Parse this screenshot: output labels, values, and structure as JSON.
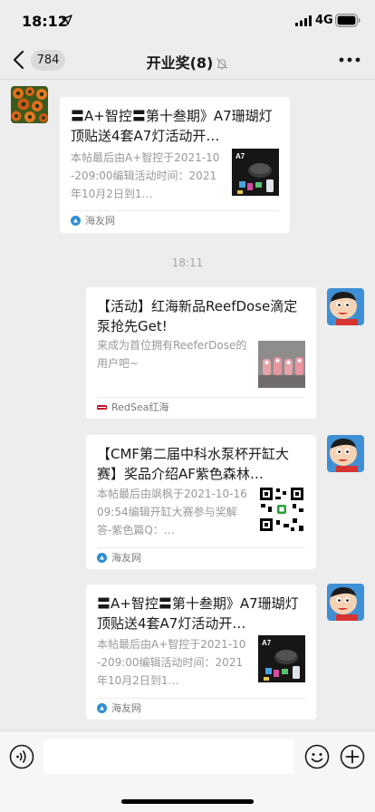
{
  "status_bar": {
    "time": "18:12",
    "network": "4G"
  },
  "nav": {
    "back_count": "784",
    "title": "开业奖(8)"
  },
  "timestamp": "18:11",
  "messages": [
    {
      "title": "〓A+智控〓第十叁期》A7珊瑚灯顶贴送4套A7灯活动开…",
      "desc": "本帖最后由A+智控于2021-10-209:00编辑活动时间：2021年10月2日到1…",
      "source": "海友网",
      "thumb_label": "A7"
    },
    {
      "title": "【活动】红海新品ReefDose滴定泵抢先Get!",
      "desc": "来成为首位拥有ReeferDose的用户吧~",
      "source": "RedSea红海"
    },
    {
      "title": "【CMF第二届中科水泵杯开缸大赛】奖品介绍AF紫色森林…",
      "desc": "本帖最后由飒枫于2021-10-1609:54编辑开缸大赛参与奖解答-紫色篇Q：…",
      "source": "海友网"
    },
    {
      "title": "〓A+智控〓第十叁期》A7珊瑚灯顶贴送4套A7灯活动开…",
      "desc": "本帖最后由A+智控于2021-10-209:00编辑活动时间：2021年10月2日到1…",
      "source": "海友网",
      "thumb_label": "A7"
    }
  ],
  "colors": {
    "background": "#ededed",
    "card": "#ffffff",
    "input_bar": "#f6f6f6",
    "badge": "#dadada"
  },
  "icons": [
    "location-arrow-icon",
    "signal-icon",
    "battery-icon",
    "back-icon",
    "mute-icon",
    "more-icon",
    "voice-icon",
    "emoji-icon",
    "add-icon"
  ]
}
